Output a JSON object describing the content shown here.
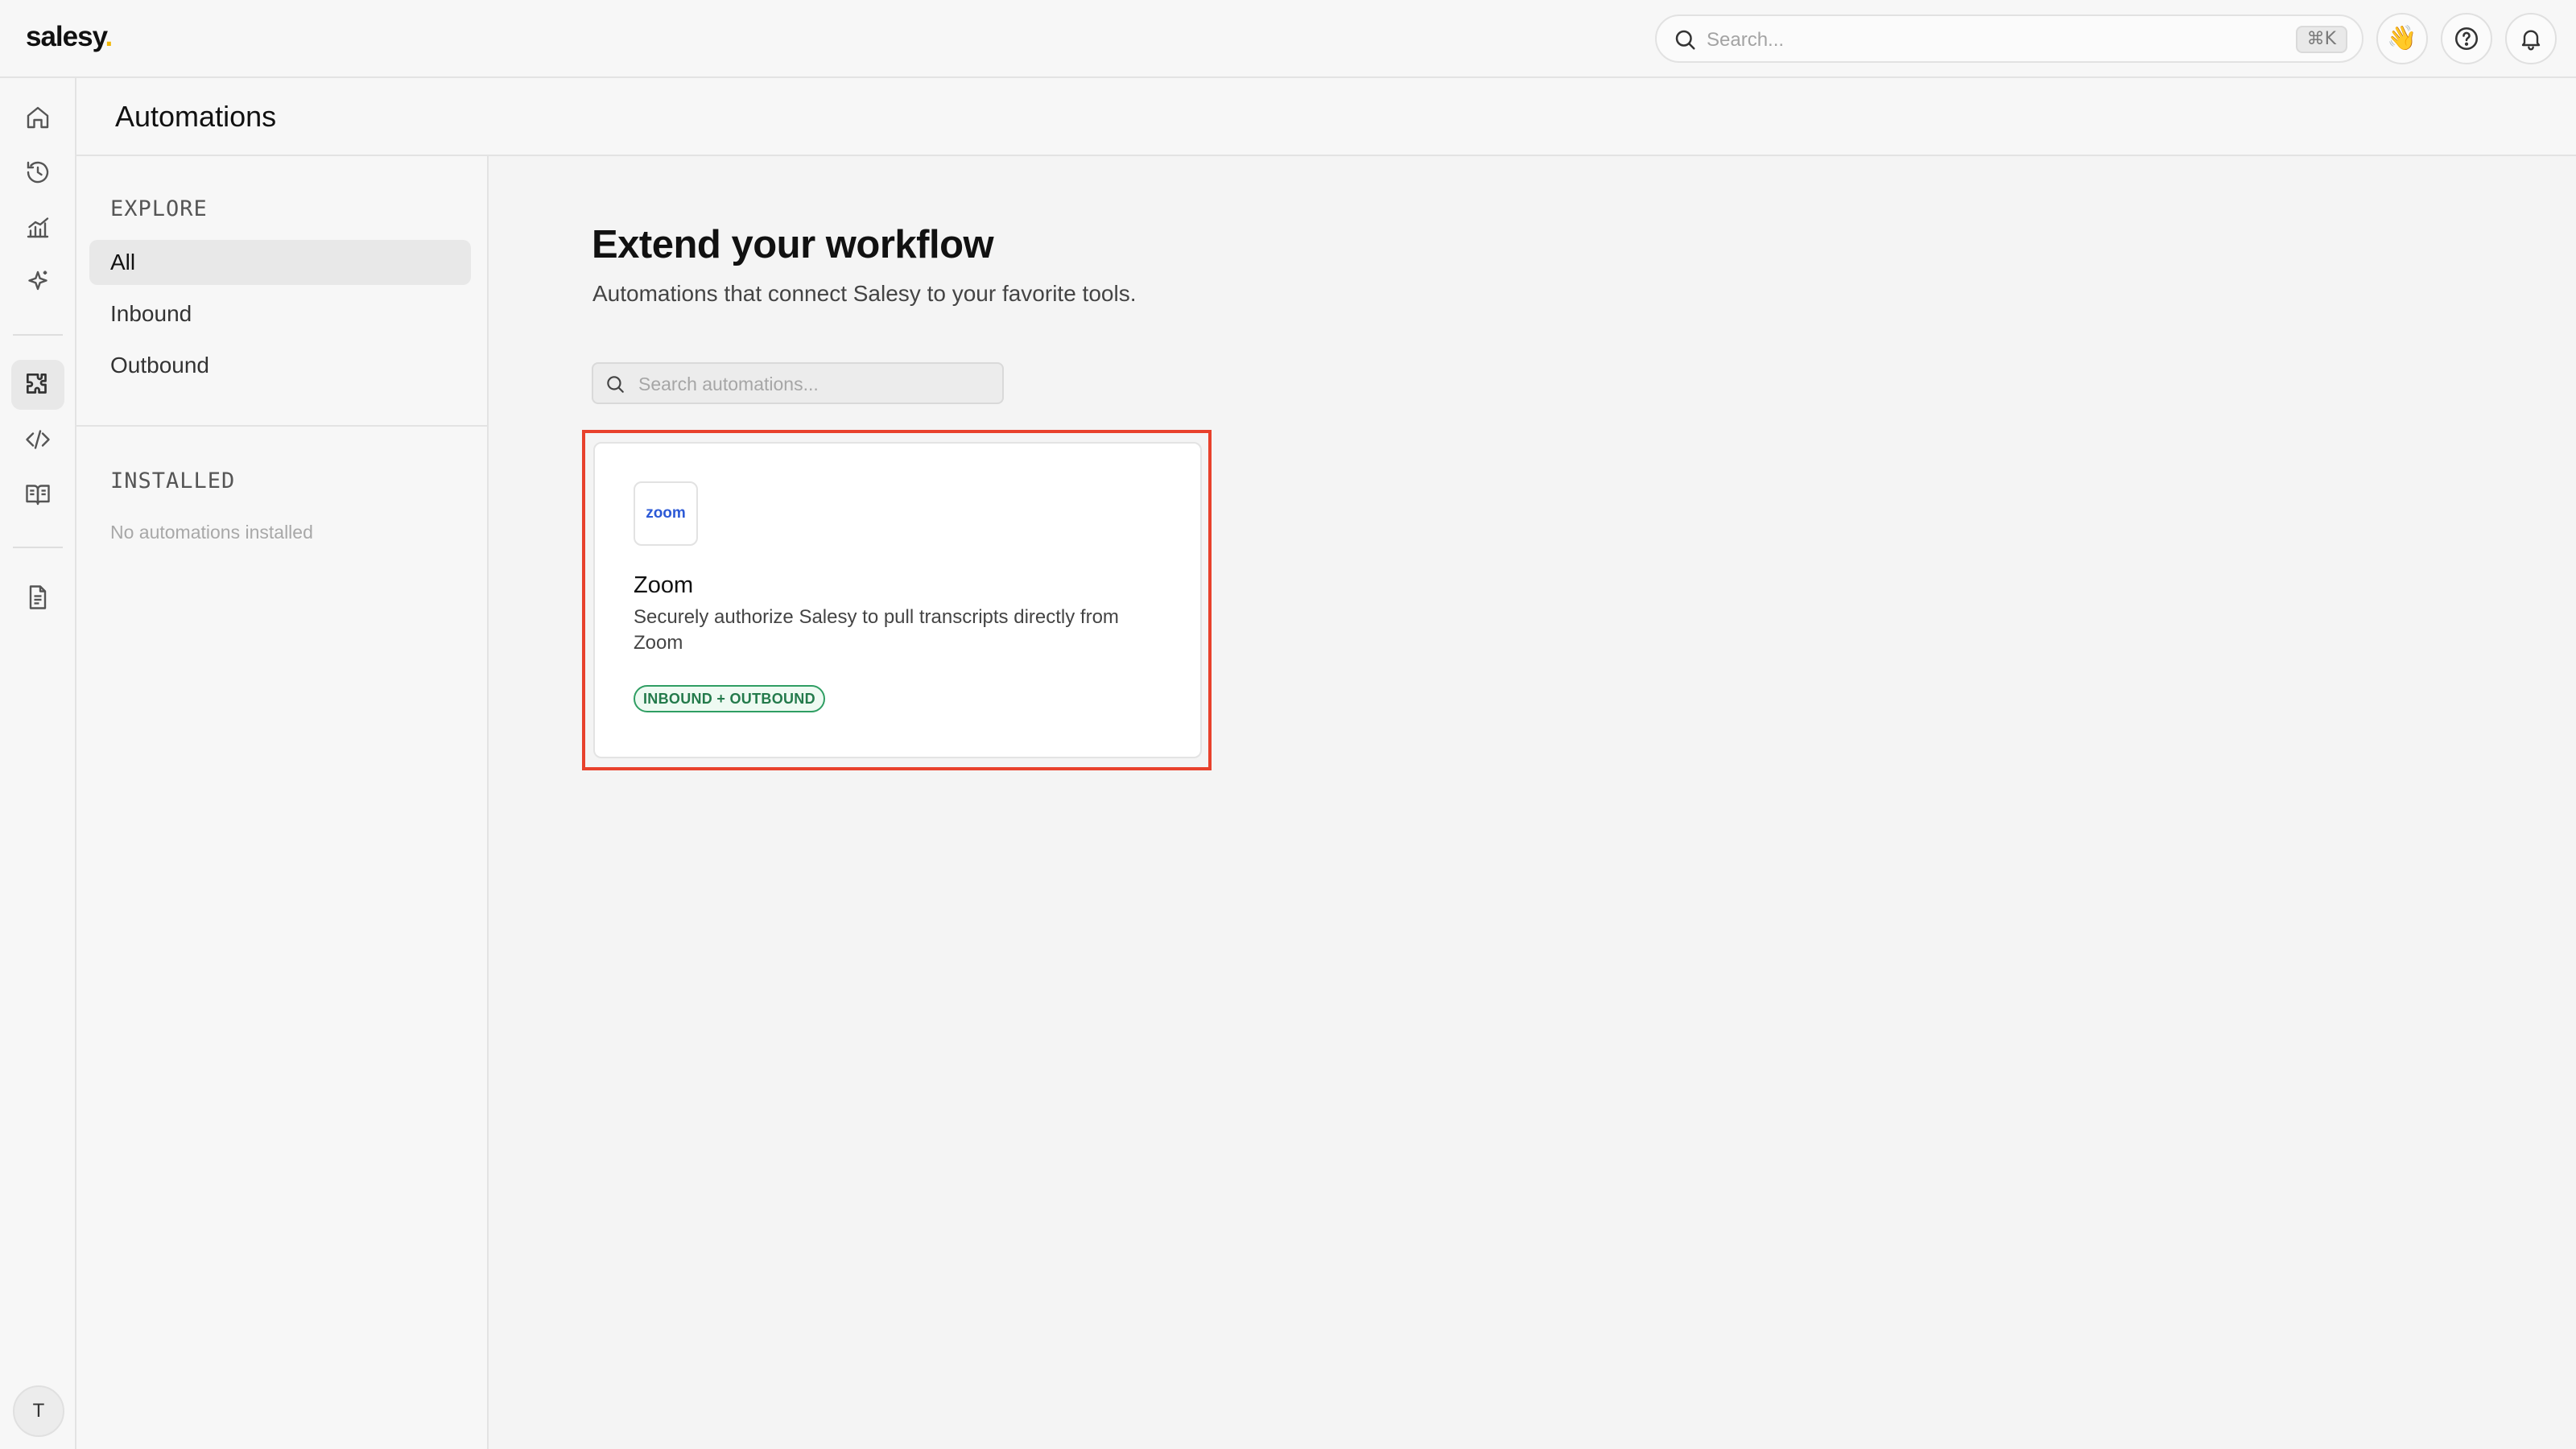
{
  "app": {
    "logo_text": "salesy",
    "logo_dot": "."
  },
  "topbar": {
    "search_placeholder": "Search...",
    "shortcut": "⌘K",
    "wave_emoji": "👋",
    "icons": [
      "search-icon",
      "wave-emoji",
      "help-icon",
      "bell-icon"
    ]
  },
  "rail": {
    "items": [
      {
        "icon": "home-icon"
      },
      {
        "icon": "history-icon"
      },
      {
        "icon": "analytics-icon"
      },
      {
        "icon": "sparkle-icon"
      },
      {
        "icon": "puzzle-icon",
        "active": true
      },
      {
        "icon": "code-icon"
      },
      {
        "icon": "book-icon"
      },
      {
        "icon": "document-icon"
      }
    ],
    "avatar_initial": "T"
  },
  "page": {
    "title": "Automations"
  },
  "subnav": {
    "explore_label": "EXPLORE",
    "items": [
      {
        "label": "All",
        "active": true
      },
      {
        "label": "Inbound"
      },
      {
        "label": "Outbound"
      }
    ],
    "installed_label": "INSTALLED",
    "installed_empty": "No automations installed"
  },
  "main": {
    "title": "Extend your workflow",
    "subtitle": "Automations that connect Salesy to your favorite tools.",
    "search_placeholder": "Search automations...",
    "cards": [
      {
        "logo_text": "zoom",
        "title": "Zoom",
        "description": "Securely authorize Salesy to pull transcripts directly from Zoom",
        "tag": "INBOUND + OUTBOUND"
      }
    ]
  },
  "colors": {
    "accent_logo_dot": "#f2b705",
    "highlight_border": "#e8412c",
    "tag_green": "#237a4b",
    "zoom_blue": "#2d5ad6"
  }
}
